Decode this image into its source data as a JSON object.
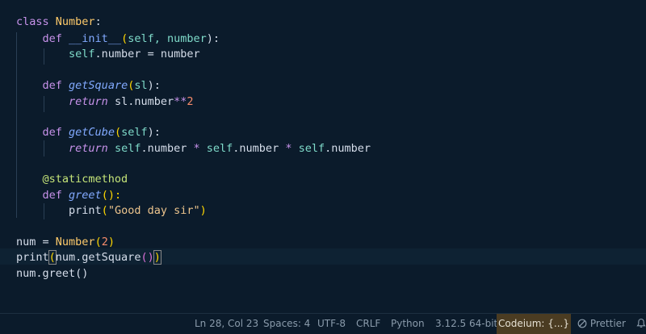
{
  "code": {
    "line1": {
      "kw": "class",
      "name": "Number",
      "colon": ":"
    },
    "line2": {
      "kw": "def",
      "name": "__init__",
      "params": "self, number",
      "end": "):"
    },
    "line3": {
      "self": "self",
      "rest": ".number = number"
    },
    "line5": {
      "kw": "def",
      "name": "getSquare",
      "params": "sl",
      "end": "):"
    },
    "line6": {
      "ret": "return",
      "rest": " sl.number",
      "op": "**",
      "num": "2"
    },
    "line8": {
      "kw": "def",
      "name": "getCube",
      "params": "self",
      "end": "):"
    },
    "line9": {
      "ret": "return",
      "self1": "self",
      "mid1": ".number ",
      "op1": "*",
      "self2": "self",
      "mid2": ".number ",
      "op2": "*",
      "self3": "self",
      "mid3": ".number"
    },
    "line11": {
      "dec": "@staticmethod"
    },
    "line12": {
      "kw": "def",
      "name": "greet",
      "end": "():"
    },
    "line13": {
      "fn": "print",
      "open": "(",
      "str": "\"Good day sir\"",
      "close": ")"
    },
    "line15": {
      "lhs": "num = ",
      "cls": "Number",
      "open": "(",
      "num": "2",
      "close": ")"
    },
    "line16": {
      "fn": "print",
      "open": "(",
      "arg": "num.getSquare",
      "inner": "()",
      "close": ")"
    },
    "line17": {
      "text": "num.greet()"
    }
  },
  "status": {
    "position": "Ln 28, Col 23",
    "spaces": "Spaces: 4",
    "encoding": "UTF-8",
    "eol": "CRLF",
    "language": "Python",
    "interpreter": "3.12.5 64-bit",
    "codeium": "Codeium: {...}",
    "prettier": "Prettier",
    "prettier_icon": "circle-slash-icon",
    "bell_icon": "bell-icon"
  }
}
